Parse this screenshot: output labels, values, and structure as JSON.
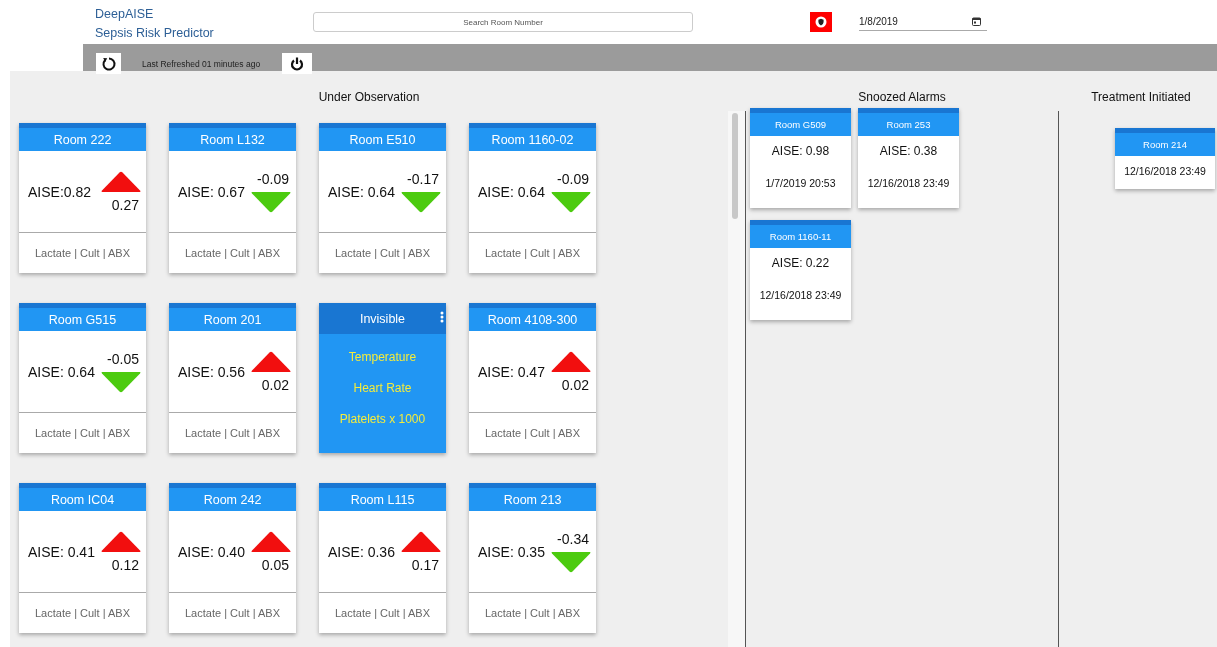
{
  "app": {
    "name": "DeepAISE",
    "subtitle": "Sepsis Risk Predictor"
  },
  "search": {
    "placeholder": "Search Room Number"
  },
  "date": {
    "value": "1/8/2019"
  },
  "toolbar": {
    "refreshed": "Last Refreshed 01 minutes ago"
  },
  "observation": {
    "title": "Under Observation",
    "cards": [
      {
        "kind": "room",
        "room": "Room 222",
        "score": "AISE:0.82",
        "rising": true,
        "delta": "0.27",
        "footer": "Lactate | Cult | ABX"
      },
      {
        "kind": "room",
        "room": "Room L132",
        "score": "AISE: 0.67",
        "rising": false,
        "delta": "-0.09",
        "footer": "Lactate | Cult | ABX"
      },
      {
        "kind": "room",
        "room": "Room E510",
        "score": "AISE: 0.64",
        "rising": false,
        "delta": "-0.17",
        "footer": "Lactate | Cult | ABX"
      },
      {
        "kind": "room",
        "room": "Room 1160-02",
        "score": "AISE: 0.64",
        "rising": false,
        "delta": "-0.09",
        "footer": "Lactate | Cult | ABX"
      },
      {
        "kind": "room",
        "room": "Room G515",
        "score": "AISE: 0.64",
        "rising": false,
        "delta": "-0.05",
        "footer": "Lactate | Cult | ABX"
      },
      {
        "kind": "room",
        "room": "Room 201",
        "score": "AISE: 0.56",
        "rising": true,
        "delta": "0.02",
        "footer": "Lactate | Cult | ABX"
      },
      {
        "kind": "menu",
        "title": "Invisible",
        "items": [
          "Temperature",
          "Heart Rate",
          "Platelets x 1000"
        ]
      },
      {
        "kind": "room",
        "room": "Room 4108-300",
        "score": "AISE: 0.47",
        "rising": true,
        "delta": "0.02",
        "footer": "Lactate | Cult | ABX"
      },
      {
        "kind": "room",
        "room": "Room IC04",
        "score": "AISE: 0.41",
        "rising": true,
        "delta": "0.12",
        "footer": "Lactate | Cult | ABX"
      },
      {
        "kind": "room",
        "room": "Room 242",
        "score": "AISE: 0.40",
        "rising": true,
        "delta": "0.05",
        "footer": "Lactate | Cult | ABX"
      },
      {
        "kind": "room",
        "room": "Room L115",
        "score": "AISE: 0.36",
        "rising": true,
        "delta": "0.17",
        "footer": "Lactate | Cult | ABX"
      },
      {
        "kind": "room",
        "room": "Room 213",
        "score": "AISE: 0.35",
        "rising": false,
        "delta": "-0.34",
        "footer": "Lactate | Cult | ABX"
      }
    ]
  },
  "snoozed": {
    "title": "Snoozed Alarms",
    "cards": [
      {
        "room": "Room G509",
        "score": "AISE: 0.98",
        "time": "1/7/2019 20:53"
      },
      {
        "room": "Room 253",
        "score": "AISE: 0.38",
        "time": "12/16/2018 23:49"
      },
      {
        "room": "Room 1160-11",
        "score": "AISE: 0.22",
        "time": "12/16/2018 23:49"
      }
    ]
  },
  "treatment": {
    "title": "Treatment Initiated",
    "cards": [
      {
        "room": "Room 214",
        "time": "12/16/2018 23:49"
      }
    ]
  }
}
